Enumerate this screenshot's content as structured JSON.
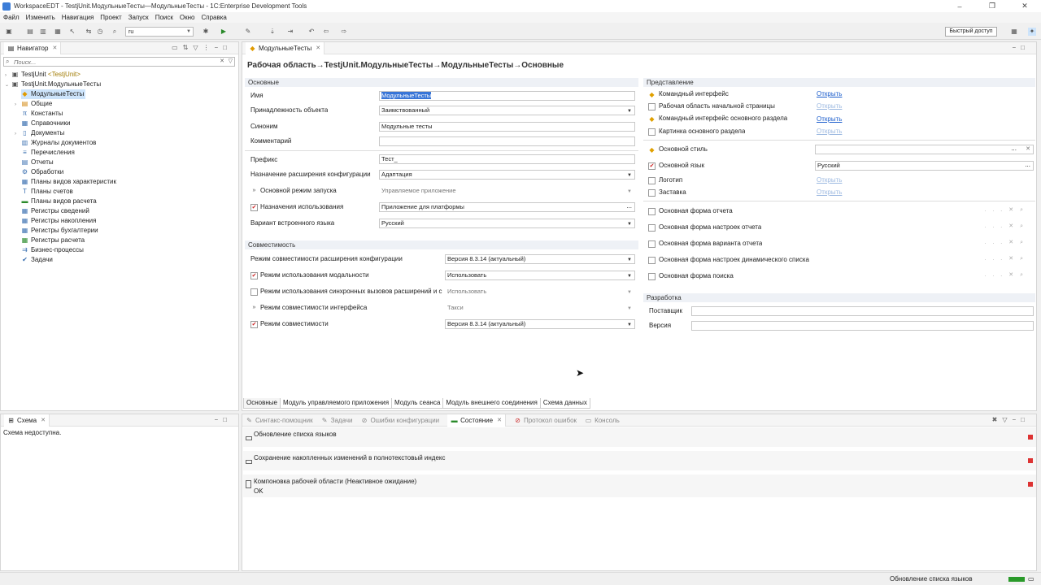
{
  "window": {
    "title": "WorkspaceEDT - TestjUnit.МодульныеТесты—МодульныеТесты - 1C:Enterprise Development Tools",
    "controls": {
      "minimize": "–",
      "restore": "❐",
      "close": "✕"
    }
  },
  "menu": [
    "Файл",
    "Изменить",
    "Навигация",
    "Проект",
    "Запуск",
    "Поиск",
    "Окно",
    "Справка"
  ],
  "toolbar": {
    "language": "ru",
    "quick_access": "Быстрый доступ"
  },
  "navigator": {
    "tab": "Навигатор",
    "search_placeholder": "Поиск...",
    "tree": [
      {
        "label": "TestjUnit",
        "suffix": "<TestjUnit>"
      },
      {
        "label": "TestjUnit.МодульныеТесты"
      },
      {
        "label": "МодульныеТесты"
      },
      {
        "label": "Общие"
      },
      {
        "label": "Константы"
      },
      {
        "label": "Справочники"
      },
      {
        "label": "Документы"
      },
      {
        "label": "Журналы документов"
      },
      {
        "label": "Перечисления"
      },
      {
        "label": "Отчеты"
      },
      {
        "label": "Обработки"
      },
      {
        "label": "Планы видов характеристик"
      },
      {
        "label": "Планы счетов"
      },
      {
        "label": "Планы видов расчета"
      },
      {
        "label": "Регистры сведений"
      },
      {
        "label": "Регистры накопления"
      },
      {
        "label": "Регистры бухгалтерии"
      },
      {
        "label": "Регистры расчета"
      },
      {
        "label": "Бизнес-процессы"
      },
      {
        "label": "Задачи"
      }
    ]
  },
  "schema": {
    "tab": "Схема",
    "message": "Схема недоступна."
  },
  "editor": {
    "tab": "МодульныеТесты",
    "breadcrumb": "Рабочая область→TestjUnit.МодульныеТесты→МодульныеТесты→Основные",
    "main": {
      "title": "Основные",
      "fields": [
        {
          "label": "Имя",
          "value": "МодульныеТесты"
        },
        {
          "label": "Принадлежность объекта",
          "value": "Заимствованный"
        },
        {
          "label": "Синоним",
          "value": "Модульные тесты"
        },
        {
          "label": "Комментарий",
          "value": ""
        },
        {
          "label": "Префикс",
          "value": "Тест_"
        },
        {
          "label": "Назначение расширения конфигурации",
          "value": "Адаптация"
        },
        {
          "label": "Основной режим запуска",
          "value": "Управляемое приложение"
        },
        {
          "label": "Назначения использования",
          "value": "Приложение для платформы"
        },
        {
          "label": "Вариант встроенного языка",
          "value": "Русский"
        }
      ]
    },
    "compat": {
      "title": "Совместимость",
      "fields": [
        {
          "label": "Режим совместимости расширения конфигурации",
          "value": "Версия 8.3.14 (актуальный)"
        },
        {
          "label": "Режим использования модальности",
          "value": "Использовать"
        },
        {
          "label": "Режим использования синхронных вызовов расширений и с",
          "value": "Использовать"
        },
        {
          "label": "Режим совместимости интерфейса",
          "value": "Такси"
        },
        {
          "label": "Режим совместимости",
          "value": "Версия 8.3.14 (актуальный)"
        }
      ]
    },
    "view": {
      "title": "Представление",
      "items": [
        {
          "label": "Командный интерфейс",
          "link": "Открыть"
        },
        {
          "label": "Рабочая область начальной страницы",
          "link": "Открыть"
        },
        {
          "label": "Командный интерфейс основного раздела",
          "link": "Открыть"
        },
        {
          "label": "Картинка основного раздела",
          "link": "Открыть"
        },
        {
          "label": "Основной стиль",
          "value": ""
        },
        {
          "label": "Основной язык",
          "value": "Русский"
        },
        {
          "label": "Логотип",
          "link": "Открыть"
        },
        {
          "label": "Заставка",
          "link": "Открыть"
        },
        {
          "label": "Основная форма отчета"
        },
        {
          "label": "Основная форма настроек отчета"
        },
        {
          "label": "Основная форма варианта отчета"
        },
        {
          "label": "Основная форма настроек динамического списка"
        },
        {
          "label": "Основная форма поиска"
        }
      ]
    },
    "dev": {
      "title": "Разработка",
      "supplier": "Поставщик",
      "version": "Версия"
    },
    "bottom_tabs": [
      "Основные",
      "Модуль управляемого приложения",
      "Модуль сеанса",
      "Модуль внешнего соединения",
      "Схема данных"
    ]
  },
  "bottom_panel": {
    "tabs": [
      "Синтакс-помощник",
      "Задачи",
      "Ошибки конфигурации",
      "Состояние",
      "Протокол ошибок",
      "Консоль"
    ],
    "rows": [
      {
        "text": "Обновление списка языков"
      },
      {
        "text": "Сохранение накопленных изменений в полнотекстовый индекс"
      },
      {
        "text": "Компоновка рабочей области (Неактивное ожидание)",
        "status": "OK"
      }
    ]
  },
  "statusbar": {
    "text": "Обновление списка языков"
  }
}
